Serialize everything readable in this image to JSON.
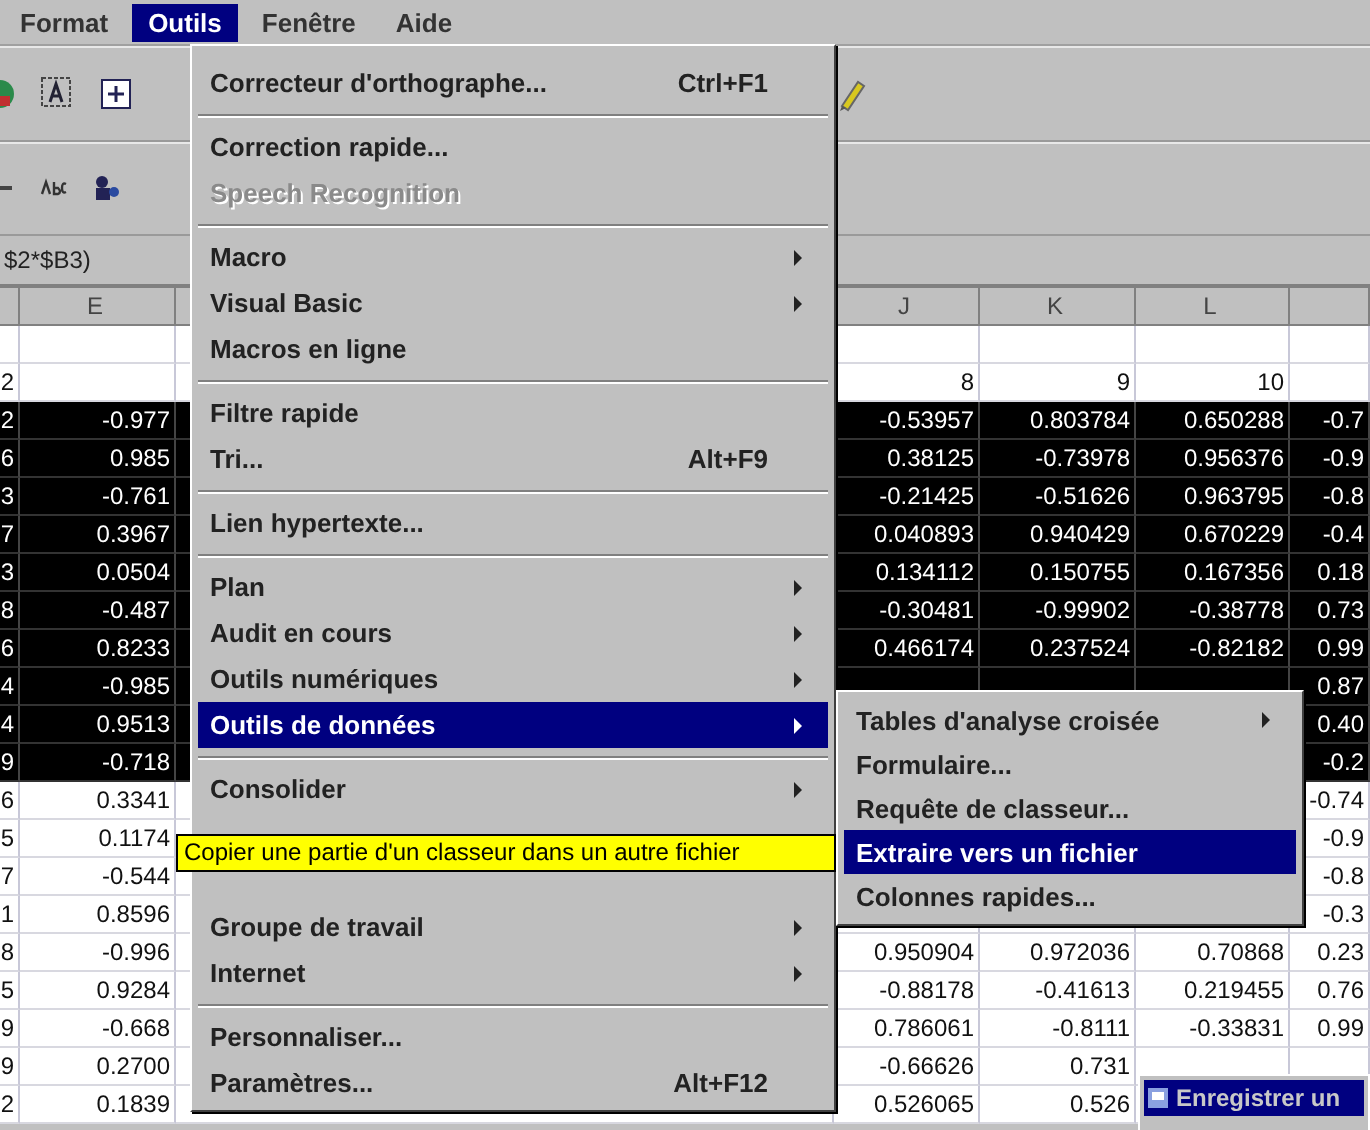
{
  "menubar": [
    {
      "label": "Format",
      "selected": false
    },
    {
      "label": "Outils",
      "selected": true
    },
    {
      "label": "Fenêtre",
      "selected": false
    },
    {
      "label": "Aide",
      "selected": false
    }
  ],
  "formula_bar": {
    "text": "$2*$B3)"
  },
  "columns": [
    null,
    "E",
    null,
    "J",
    "K",
    "L",
    null
  ],
  "rows": [
    {
      "selected": false,
      "cells": [
        null,
        null,
        null,
        null,
        null,
        null
      ]
    },
    {
      "selected": false,
      "cells": [
        "2",
        null,
        "8",
        "9",
        "10",
        null
      ]
    },
    {
      "selected": true,
      "cells": [
        "2",
        "-0.977",
        "-0.53957",
        "0.803784",
        "0.650288",
        "-0.7"
      ]
    },
    {
      "selected": true,
      "cells": [
        "6",
        "0.985",
        "0.38125",
        "-0.73978",
        "0.956376",
        "-0.9"
      ]
    },
    {
      "selected": true,
      "cells": [
        "3",
        "-0.761",
        "-0.21425",
        "-0.51626",
        "0.963795",
        "-0.8"
      ]
    },
    {
      "selected": true,
      "cells": [
        "7",
        "0.3967",
        "0.040893",
        "0.940429",
        "0.670229",
        "-0.4"
      ]
    },
    {
      "selected": true,
      "cells": [
        "3",
        "0.0504",
        "0.134112",
        "0.150755",
        "0.167356",
        "0.18"
      ]
    },
    {
      "selected": true,
      "cells": [
        "8",
        "-0.487",
        "-0.30481",
        "-0.99902",
        "-0.38778",
        "0.73"
      ]
    },
    {
      "selected": true,
      "cells": [
        "6",
        "0.8233",
        "0.466174",
        "0.237524",
        "-0.82182",
        "0.99"
      ]
    },
    {
      "selected": true,
      "cells": [
        "4",
        "-0.985",
        null,
        null,
        null,
        "0.87"
      ]
    },
    {
      "selected": true,
      "cells": [
        "4",
        "0.9513",
        null,
        null,
        null,
        "0.40"
      ]
    },
    {
      "selected": true,
      "cells": [
        "9",
        "-0.718",
        null,
        null,
        null,
        "-0.2"
      ]
    },
    {
      "selected": false,
      "cells": [
        "6",
        "0.3341",
        null,
        null,
        null,
        "-0.74"
      ]
    },
    {
      "selected": false,
      "cells": [
        "5",
        "0.1174",
        null,
        null,
        null,
        "-0.9"
      ]
    },
    {
      "selected": false,
      "cells": [
        "7",
        "-0.544",
        null,
        null,
        null,
        "-0.8"
      ]
    },
    {
      "selected": false,
      "cells": [
        "1",
        "0.8596",
        null,
        null,
        null,
        "-0.3"
      ]
    },
    {
      "selected": false,
      "cells": [
        "8",
        "-0.996",
        "0.950904",
        "0.972036",
        "0.70868",
        "0.23"
      ]
    },
    {
      "selected": false,
      "cells": [
        "5",
        "0.9284",
        "-0.88178",
        "-0.41613",
        "0.219455",
        "0.76"
      ]
    },
    {
      "selected": false,
      "cells": [
        "9",
        "-0.668",
        "0.786061",
        "-0.8111",
        "-0.33831",
        "0.99"
      ]
    },
    {
      "selected": false,
      "cells": [
        "9",
        "0.2700",
        "-0.66626",
        "0.731",
        null,
        null
      ]
    },
    {
      "selected": false,
      "cells": [
        "2",
        "0.1839",
        "0.526065",
        "0.526",
        null,
        null
      ]
    }
  ],
  "menu": [
    {
      "kind": "item",
      "label": "Correcteur d'orthographe...",
      "shortcut": "Ctrl+F1",
      "submenu": false,
      "disabled": false,
      "selected": false
    },
    {
      "kind": "separator"
    },
    {
      "kind": "item",
      "label": "Correction rapide...",
      "submenu": false,
      "disabled": false,
      "selected": false
    },
    {
      "kind": "item",
      "label": "Speech Recognition",
      "submenu": false,
      "disabled": true,
      "selected": false
    },
    {
      "kind": "separator"
    },
    {
      "kind": "item",
      "label": "Macro",
      "submenu": true,
      "disabled": false,
      "selected": false
    },
    {
      "kind": "item",
      "label": "Visual Basic",
      "submenu": true,
      "disabled": false,
      "selected": false
    },
    {
      "kind": "item",
      "label": "Macros en ligne",
      "submenu": false,
      "disabled": false,
      "selected": false
    },
    {
      "kind": "separator"
    },
    {
      "kind": "item",
      "label": "Filtre rapide",
      "submenu": false,
      "disabled": false,
      "selected": false
    },
    {
      "kind": "item",
      "label": "Tri...",
      "shortcut": "Alt+F9",
      "submenu": false,
      "disabled": false,
      "selected": false
    },
    {
      "kind": "separator"
    },
    {
      "kind": "item",
      "label": "Lien hypertexte...",
      "submenu": false,
      "disabled": false,
      "selected": false
    },
    {
      "kind": "separator"
    },
    {
      "kind": "item",
      "label": "Plan",
      "submenu": true,
      "disabled": false,
      "selected": false
    },
    {
      "kind": "item",
      "label": "Audit en cours",
      "submenu": true,
      "disabled": false,
      "selected": false
    },
    {
      "kind": "item",
      "label": "Outils numériques",
      "submenu": true,
      "disabled": false,
      "selected": false
    },
    {
      "kind": "item",
      "label": "Outils de données",
      "submenu": true,
      "disabled": false,
      "selected": true
    },
    {
      "kind": "separator"
    },
    {
      "kind": "item",
      "label": "Consolider",
      "submenu": true,
      "disabled": false,
      "selected": false
    },
    {
      "kind": "covered"
    },
    {
      "kind": "covered"
    },
    {
      "kind": "item",
      "label": "Groupe de travail",
      "submenu": true,
      "disabled": false,
      "selected": false
    },
    {
      "kind": "item",
      "label": "Internet",
      "submenu": true,
      "disabled": false,
      "selected": false
    },
    {
      "kind": "separator"
    },
    {
      "kind": "item",
      "label": "Personnaliser...",
      "submenu": false,
      "disabled": false,
      "selected": false
    },
    {
      "kind": "item",
      "label": "Paramètres...",
      "shortcut": "Alt+F12",
      "submenu": false,
      "disabled": false,
      "selected": false
    }
  ],
  "submenu": [
    {
      "label": "Tables d'analyse croisée",
      "submenu": true,
      "selected": false
    },
    {
      "label": "Formulaire...",
      "submenu": false,
      "selected": false
    },
    {
      "label": "Requête de classeur...",
      "submenu": false,
      "selected": false
    },
    {
      "label": "Extraire vers un fichier",
      "submenu": false,
      "selected": true
    },
    {
      "label": "Colonnes rapides...",
      "submenu": false,
      "selected": false
    }
  ],
  "tooltip": {
    "text": "Copier une partie d'un classeur dans un autre fichier"
  },
  "floating_window": {
    "title": "Enregistrer un"
  }
}
